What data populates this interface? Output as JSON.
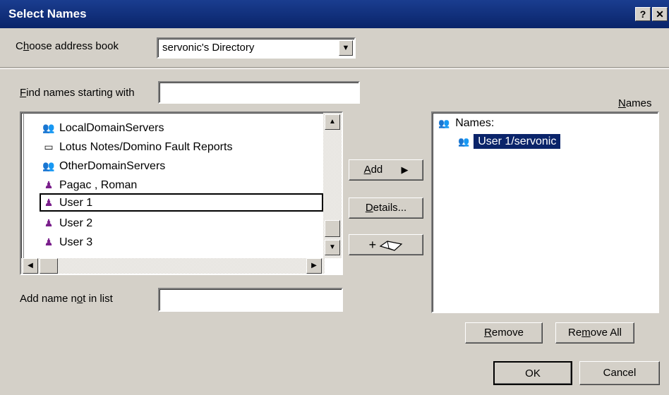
{
  "window": {
    "title": "Select Names",
    "help_glyph": "?",
    "close_glyph": "✕"
  },
  "address_book": {
    "label_prefix": "C",
    "label_accel": "h",
    "label_rest": "oose address book",
    "selected": "servonic's Directory"
  },
  "find": {
    "label_accel": "F",
    "label_rest": "ind names starting with",
    "value": ""
  },
  "directory_list": {
    "items": [
      {
        "label": "LocalDomainServers",
        "icon": "group-icon"
      },
      {
        "label": "Lotus Notes/Domino Fault Reports",
        "icon": "folder-icon"
      },
      {
        "label": "OtherDomainServers",
        "icon": "group-icon"
      },
      {
        "label": "Pagac , Roman",
        "icon": "person-icon"
      },
      {
        "label": "User 1",
        "icon": "person-icon"
      },
      {
        "label": "User 2",
        "icon": "person-icon"
      },
      {
        "label": "User 3",
        "icon": "person-icon"
      }
    ]
  },
  "actions": {
    "add_accel": "A",
    "add_rest": "dd",
    "details_accel": "D",
    "details_rest": "etails...",
    "add_book_label": "+"
  },
  "add_not_in_list": {
    "label_a": "Add name n",
    "label_accel": "o",
    "label_b": "t in list",
    "value": ""
  },
  "names_panel": {
    "header_accel": "N",
    "header_rest": "ames",
    "root_label": "Names:",
    "child_label": "User 1/servonic"
  },
  "buttons": {
    "remove_accel": "R",
    "remove_rest": "emove",
    "remove_all_a": "Re",
    "remove_all_accel": "m",
    "remove_all_b": "ove All",
    "ok": "OK",
    "cancel": "Cancel"
  },
  "colors": {
    "title_bg": "#0a246a",
    "dialog_bg": "#d4d0c8",
    "selection_bg": "#0a246a",
    "person_icon": "#7a1f8c",
    "group_icon": "#3a3aa8"
  }
}
